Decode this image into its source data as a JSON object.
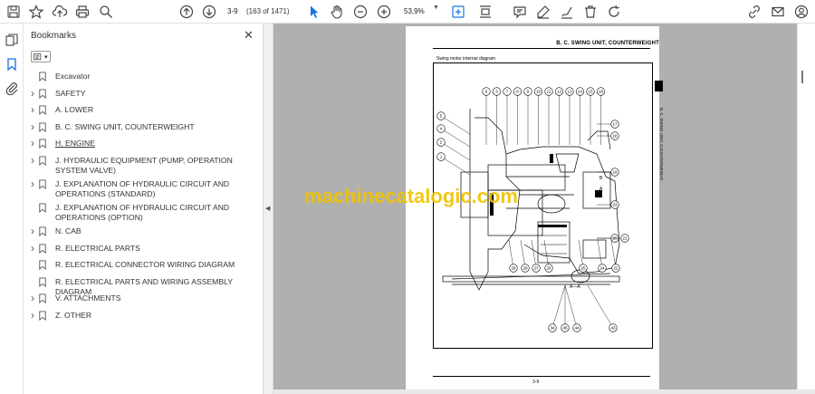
{
  "toolbar": {
    "page_current": "3-9",
    "page_count": "(163 of 1471)",
    "zoom": "53,9%"
  },
  "bookmarks": {
    "title": "Bookmarks",
    "items": [
      {
        "label": "Excavator",
        "expandable": false
      },
      {
        "label": "SAFETY",
        "expandable": true
      },
      {
        "label": "A. LOWER",
        "expandable": true
      },
      {
        "label": "B. C. SWING UNIT, COUNTERWEIGHT",
        "expandable": true
      },
      {
        "label": "H. ENGINE",
        "expandable": true
      },
      {
        "label": "J. HYDRAULIC EQUIPMENT (PUMP, OPERATION SYSTEM VALVE)",
        "expandable": true
      },
      {
        "label": "J. EXPLANATION OF HYDRAULIC CIRCUIT AND OPERATIONS (STANDARD)",
        "expandable": true
      },
      {
        "label": "J. EXPLANATION OF HYDRAULIC CIRCUIT AND OPERATIONS (OPTION)",
        "expandable": false
      },
      {
        "label": "N. CAB",
        "expandable": true
      },
      {
        "label": "R. ELECTRICAL PARTS",
        "expandable": true
      },
      {
        "label": "R. ELECTRICAL CONNECTOR WIRING DIAGRAM",
        "expandable": false
      },
      {
        "label": "R. ELECTRICAL PARTS AND WIRING ASSEMBLY DIAGRAM",
        "expandable": false
      },
      {
        "label": "V. ATTACHMENTS",
        "expandable": true
      },
      {
        "label": "Z. OTHER",
        "expandable": true
      }
    ]
  },
  "document_page": {
    "header": "B. C. SWING UNIT, COUNTERWEIGHT",
    "caption": "Swing motor internal diagram",
    "side_text": "B. C. SWING UNIT, COUNTERWEIGHT",
    "footer": "3-9",
    "section_label": "A—A",
    "callouts_top": [
      "6",
      "3",
      "7",
      "8",
      "9",
      "10",
      "11",
      "12",
      "13",
      "14",
      "15",
      "16"
    ],
    "callouts_left": [
      "5",
      "4",
      "2",
      "1"
    ],
    "callouts_right": [
      "17",
      "18",
      "19",
      "23",
      "20",
      "21"
    ],
    "callouts_bottom": [
      "29",
      "28",
      "27",
      "26",
      "25",
      "24",
      "22"
    ],
    "callouts_lower": [
      "34",
      "45",
      "44",
      "43"
    ]
  },
  "watermark": "machinecatalogic.com",
  "colors": {
    "accent": "#1473e6",
    "viewer_bg": "#b0b0b0",
    "watermark": "#f0c400"
  }
}
